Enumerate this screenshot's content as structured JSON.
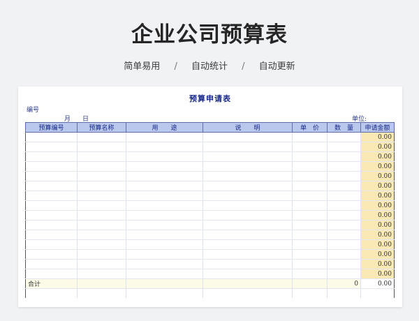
{
  "page": {
    "title": "企业公司预算表",
    "features": [
      "简单易用",
      "自动统计",
      "自动更新"
    ],
    "separator": "/"
  },
  "sheet": {
    "title": "预算申请表",
    "number_label": "编号",
    "month_label": "月",
    "day_label": "日",
    "unit_label": "单位:",
    "headers": [
      "预算编号",
      "预算名称",
      "用　　途",
      "说　　明",
      "单　价",
      "数　量",
      "申请金额"
    ],
    "rows": [
      {
        "amount": "0.00"
      },
      {
        "amount": "0.00"
      },
      {
        "amount": "0.00"
      },
      {
        "amount": "0.00"
      },
      {
        "amount": "0.00"
      },
      {
        "amount": "0.00"
      },
      {
        "amount": "0.00"
      },
      {
        "amount": "0.00"
      },
      {
        "amount": "0.00"
      },
      {
        "amount": "0.00"
      },
      {
        "amount": "0.00"
      },
      {
        "amount": "0.00"
      },
      {
        "amount": "0.00"
      },
      {
        "amount": "0.00"
      },
      {
        "amount": "0.00"
      }
    ],
    "total": {
      "label": "合计",
      "quantity": "0",
      "amount": "0.00"
    }
  }
}
